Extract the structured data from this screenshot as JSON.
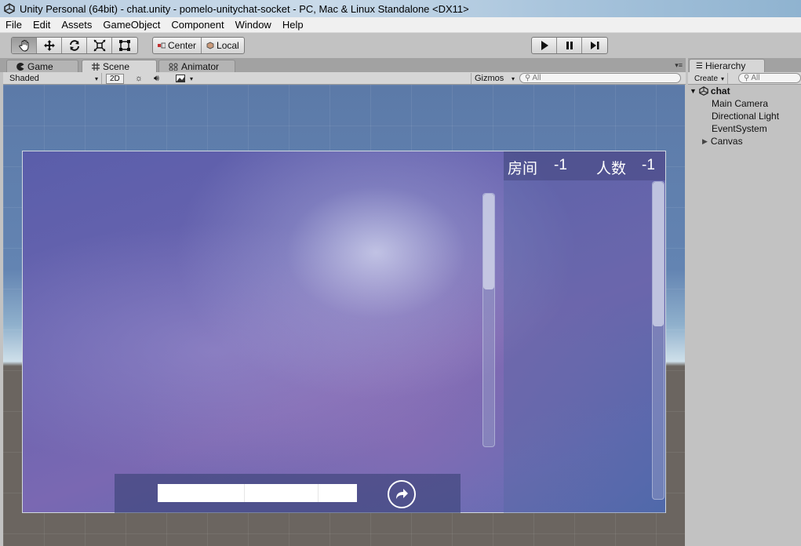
{
  "window": {
    "title": "Unity Personal (64bit) - chat.unity - pomelo-unitychat-socket - PC, Mac & Linux Standalone <DX11>"
  },
  "menu": [
    "File",
    "Edit",
    "Assets",
    "GameObject",
    "Component",
    "Window",
    "Help"
  ],
  "toolbar": {
    "tools": [
      "hand-icon",
      "move-icon",
      "rotate-icon",
      "scale-icon",
      "rect-tool-icon"
    ],
    "pivot_label": "Center",
    "space_label": "Local",
    "playback": [
      "play-icon",
      "pause-icon",
      "step-icon"
    ]
  },
  "tabs": {
    "game": "Game",
    "scene": "Scene",
    "animator": "Animator"
  },
  "scenebar": {
    "shading": "Shaded",
    "mode2d": "2D",
    "gizmos": "Gizmos",
    "search_placeholder": "All"
  },
  "scene": {
    "room_label": "房间",
    "room_value": "-1",
    "people_label": "人数",
    "people_value": "-1",
    "send_icon": "send-arrow-icon"
  },
  "hierarchy": {
    "tab_label": "Hierarchy",
    "create_label": "Create",
    "search_placeholder": "All",
    "scene_name": "chat",
    "items": [
      "Main Camera",
      "Directional Light",
      "EventSystem",
      "Canvas"
    ]
  }
}
